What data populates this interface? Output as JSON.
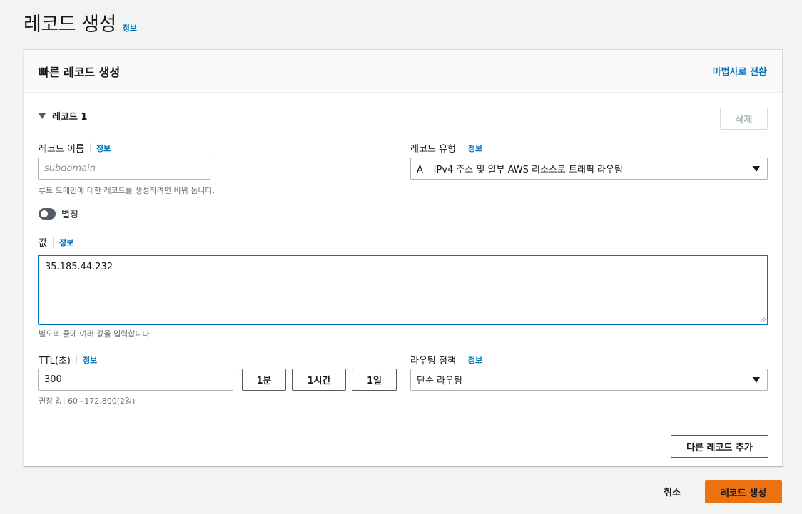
{
  "page": {
    "title": "레코드 생성",
    "info": "정보"
  },
  "panel": {
    "title": "빠른 레코드 생성",
    "wizard_link": "마법사로 전환"
  },
  "record": {
    "title": "레코드 1",
    "delete_label": "삭제",
    "name": {
      "label": "레코드 이름",
      "info": "정보",
      "placeholder": "subdomain",
      "value": "",
      "hint": "루트 도메인에 대한 레코드를 생성하려면 비워 둡니다."
    },
    "type": {
      "label": "레코드 유형",
      "info": "정보",
      "selected": "A – IPv4 주소 및 일부 AWS 리소스로 트래픽 라우팅"
    },
    "alias": {
      "label": "별칭",
      "enabled": false
    },
    "value": {
      "label": "값",
      "info": "정보",
      "text": "35.185.44.232",
      "hint": "별도의 줄에 여러 값을 입력합니다."
    },
    "ttl": {
      "label": "TTL(초)",
      "info": "정보",
      "value": "300",
      "hint": "권장 값: 60~172,800(2일)",
      "presets": [
        "1분",
        "1시간",
        "1일"
      ]
    },
    "routing": {
      "label": "라우팅 정책",
      "info": "정보",
      "selected": "단순 라우팅"
    }
  },
  "add_record_label": "다른 레코드 추가",
  "footer": {
    "cancel_label": "취소",
    "create_label": "레코드 생성"
  },
  "colors": {
    "primary": "#ec7211",
    "link": "#0073bb",
    "focus": "#0073bb"
  }
}
